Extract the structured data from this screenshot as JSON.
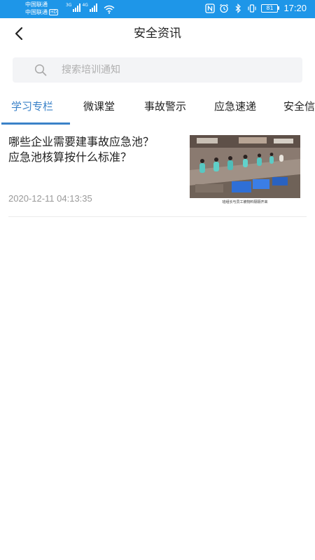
{
  "status_bar": {
    "carrier_1": "中国联通",
    "carrier_2": "中国联通",
    "hd_badge": "HD",
    "net_1": "3G",
    "net_2": "4G",
    "battery": "81",
    "time": "17:20",
    "icons": [
      "nfc-icon",
      "alarm-icon",
      "bluetooth-icon",
      "vibrate-icon",
      "battery-icon",
      "wifi-icon",
      "signal-icon"
    ]
  },
  "header": {
    "title": "安全资讯",
    "back_icon": "chevron-left-icon"
  },
  "search": {
    "placeholder": "搜索培训通知",
    "value": "",
    "icon": "search-icon"
  },
  "tabs": [
    {
      "label": "学习专栏",
      "active": true
    },
    {
      "label": "微课堂",
      "active": false
    },
    {
      "label": "事故警示",
      "active": false
    },
    {
      "label": "应急速递",
      "active": false
    },
    {
      "label": "安全信",
      "active": false
    }
  ],
  "articles": [
    {
      "title": "哪些企业需要建事故应急池？应急池核算按什么标准？",
      "date": "2020-12-11 04:13:35",
      "thumbnail_caption": "班组长与员工被物料隔隔开来"
    }
  ],
  "colors": {
    "status_bar": "#1e96e8",
    "accent": "#3b82c8",
    "search_bg": "#f3f4f6",
    "date_text": "#999999"
  }
}
